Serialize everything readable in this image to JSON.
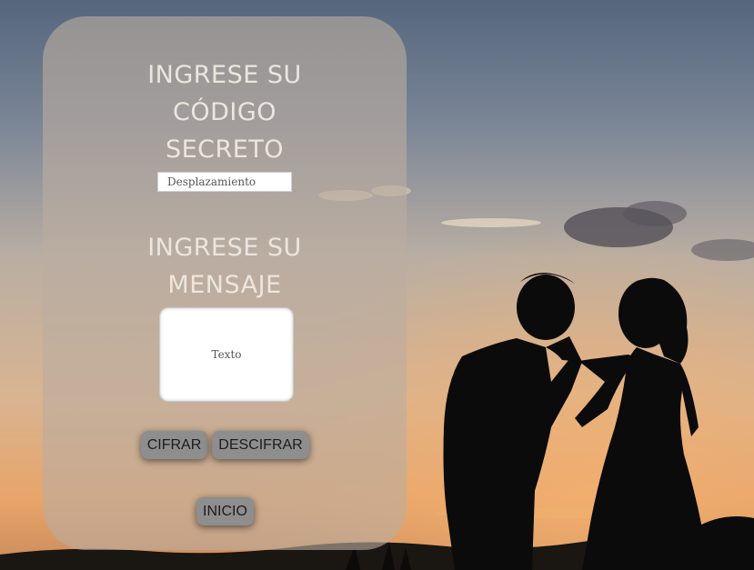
{
  "form": {
    "code_heading": [
      "INGRESE SU",
      "CÓDIGO",
      "SECRETO"
    ],
    "shift_placeholder": "Desplazamiento",
    "message_heading": [
      "INGRESE SU",
      "MENSAJE"
    ],
    "message_placeholder": "Texto"
  },
  "actions": {
    "encrypt_label": "CIFRAR",
    "decrypt_label": "DESCIFRAR",
    "home_label": "INICIO"
  },
  "background": {
    "description_icon": "couple-sunset-photo",
    "sky_top": "#5f6f85",
    "sky_mid": "#b8a89a",
    "sky_glow": "#e4a76a",
    "silhouette": "#0b0b0b"
  }
}
